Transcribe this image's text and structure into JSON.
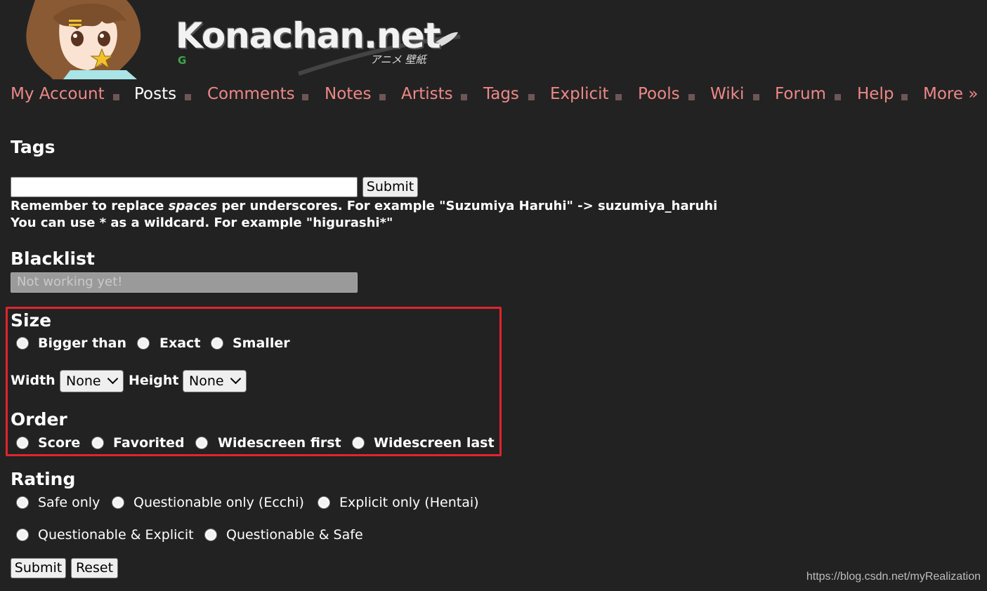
{
  "header": {
    "logo_text": "Konachan.net",
    "logo_subtitle": "アニメ 壁紙",
    "logo_badge": "G"
  },
  "nav": {
    "items": [
      {
        "label": "My Account"
      },
      {
        "label": "Posts",
        "current": true
      },
      {
        "label": "Comments"
      },
      {
        "label": "Notes"
      },
      {
        "label": "Artists"
      },
      {
        "label": "Tags"
      },
      {
        "label": "Explicit"
      },
      {
        "label": "Pools"
      },
      {
        "label": "Wiki"
      },
      {
        "label": "Forum"
      },
      {
        "label": "Help"
      },
      {
        "label": "More »"
      }
    ]
  },
  "tags": {
    "heading": "Tags",
    "input_value": "",
    "submit_label": "Submit",
    "hint_line1_pre": "Remember to replace ",
    "hint_line1_em": "spaces",
    "hint_line1_post": " per underscores. For example \"Suzumiya Haruhi\" -> suzumiya_haruhi",
    "hint_line2": "You can use * as a wildcard. For example \"higurashi*\""
  },
  "blacklist": {
    "heading": "Blacklist",
    "placeholder": "Not working yet!"
  },
  "size": {
    "heading": "Size",
    "options": [
      "Bigger than",
      "Exact",
      "Smaller"
    ],
    "width_label": "Width",
    "width_value": "None",
    "height_label": "Height",
    "height_value": "None"
  },
  "order": {
    "heading": "Order",
    "options": [
      "Score",
      "Favorited",
      "Widescreen first",
      "Widescreen last"
    ]
  },
  "rating": {
    "heading": "Rating",
    "options_row1": [
      "Safe only",
      "Questionable only (Ecchi)",
      "Explicit only (Hentai)"
    ],
    "options_row2": [
      "Questionable & Explicit",
      "Questionable & Safe"
    ]
  },
  "form": {
    "submit_label": "Submit",
    "reset_label": "Reset"
  },
  "watermark": "https://blog.csdn.net/myRealization",
  "colors": {
    "background": "#222222",
    "nav_link": "#ee8887",
    "highlight_border": "#e0242d"
  }
}
